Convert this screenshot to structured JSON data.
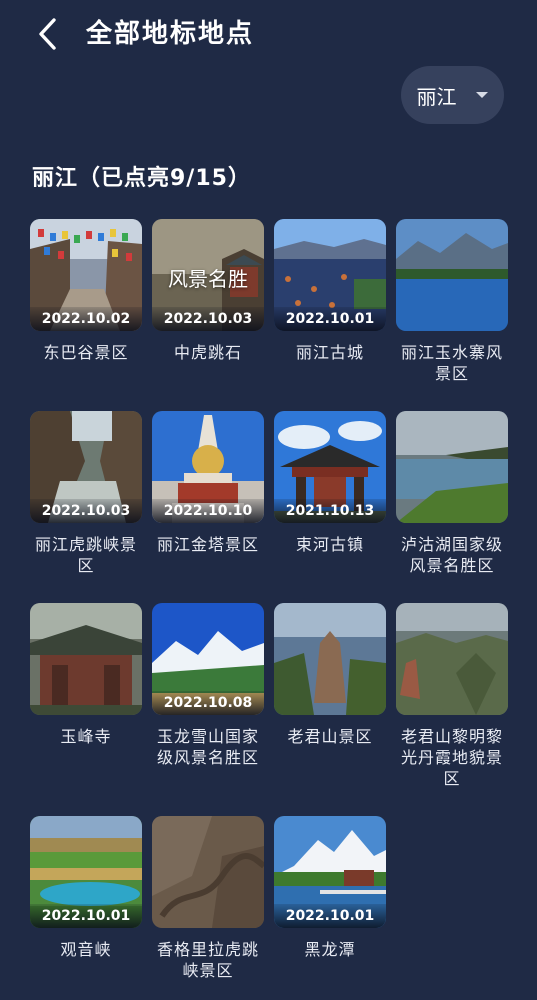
{
  "header": {
    "title": "全部地标地点",
    "back_icon": "chevron-left-icon"
  },
  "city_select": {
    "value": "丽江",
    "icon": "caret-down-icon"
  },
  "section": {
    "title": "丽江（已点亮9/15）"
  },
  "colors": {
    "background": "#1f2a45",
    "pill": "#36415d",
    "text": "#ffffff"
  },
  "places": [
    {
      "name": "东巴谷景区",
      "date": "2022.10.02",
      "lit": true,
      "theme": "prayer-flags"
    },
    {
      "name": "中虎跳石",
      "date": "2022.10.03",
      "lit": true,
      "theme": "placeholder",
      "thumb_text": "风景名胜"
    },
    {
      "name": "丽江古城",
      "date": "2022.10.01",
      "lit": true,
      "theme": "old-town"
    },
    {
      "name": "丽江玉水寨风景区",
      "date": "",
      "lit": false,
      "theme": "lake-blue"
    },
    {
      "name": "丽江虎跳峡景区",
      "date": "2022.10.03",
      "lit": true,
      "theme": "gorge"
    },
    {
      "name": "丽江金塔景区",
      "date": "2022.10.10",
      "lit": true,
      "theme": "pagoda"
    },
    {
      "name": "束河古镇",
      "date": "2021.10.13",
      "lit": true,
      "theme": "gate"
    },
    {
      "name": "泸沽湖国家级风景名胜区",
      "date": "",
      "lit": false,
      "theme": "lake-green"
    },
    {
      "name": "玉峰寺",
      "date": "",
      "lit": false,
      "theme": "temple"
    },
    {
      "name": "玉龙雪山国家级风景名胜区",
      "date": "2022.10.08",
      "lit": true,
      "theme": "snow-mountain"
    },
    {
      "name": "老君山景区",
      "date": "",
      "lit": false,
      "theme": "rock-mountain"
    },
    {
      "name": "老君山黎明黎光丹霞地貌景区",
      "date": "",
      "lit": false,
      "theme": "danxia"
    },
    {
      "name": "观音峡",
      "date": "2022.10.01",
      "lit": true,
      "theme": "terraces"
    },
    {
      "name": "香格里拉虎跳峡景区",
      "date": "",
      "lit": false,
      "theme": "brown"
    },
    {
      "name": "黑龙潭",
      "date": "2022.10.01",
      "lit": true,
      "theme": "black-dragon-pool"
    }
  ]
}
